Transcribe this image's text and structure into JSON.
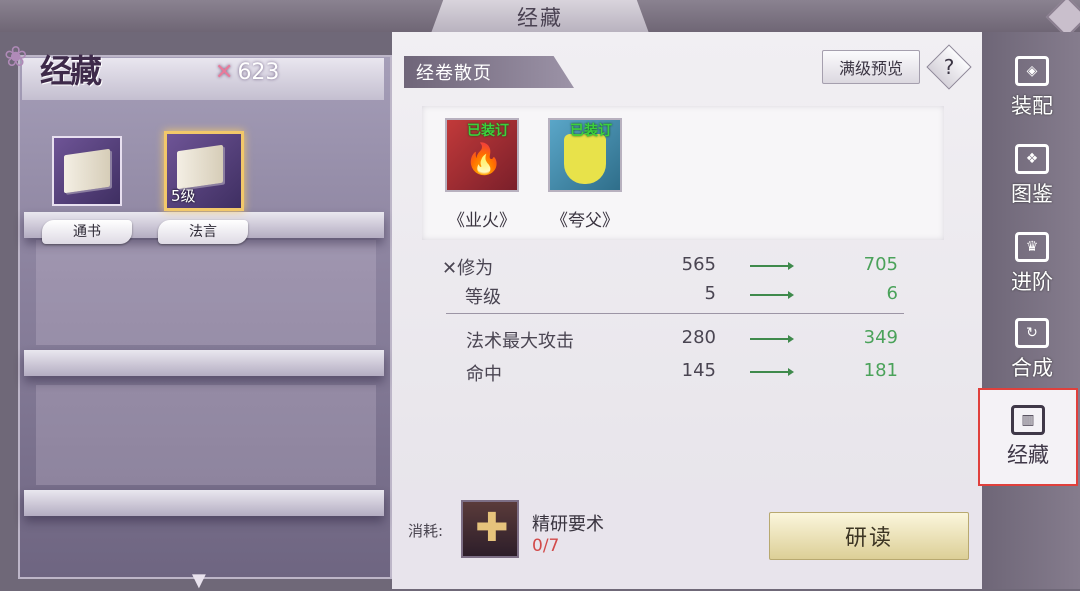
{
  "window": {
    "title": "经藏"
  },
  "left": {
    "logo_text": "经藏",
    "currency_icon": "crossed-swords-icon",
    "currency_value": "623",
    "books": [
      {
        "label": "通书",
        "level": "",
        "selected": false
      },
      {
        "label": "法言",
        "level": "5级",
        "selected": true
      }
    ]
  },
  "right": {
    "section_title": "经卷散页",
    "preview_label": "满级预览",
    "help_label": "?",
    "equipped": [
      {
        "name": "《业火》",
        "tag": "已装订",
        "icon": "fire-book-icon"
      },
      {
        "name": "《夸父》",
        "tag": "已装订",
        "icon": "yellow-scroll-icon"
      }
    ],
    "stats": [
      {
        "label": "修为",
        "icon": "crossed-swords-icon",
        "from": "565",
        "to": "705"
      },
      {
        "label": "等级",
        "from": "5",
        "to": "6"
      },
      {
        "label": "法术最大攻击",
        "from": "280",
        "to": "349"
      },
      {
        "label": "命中",
        "from": "145",
        "to": "181"
      }
    ],
    "cost": {
      "label": "消耗:",
      "item_name": "精研要术",
      "count": "0/7"
    },
    "action_button": "研读"
  },
  "sidebar": {
    "items": [
      {
        "label": "装配",
        "icon": "equip-icon",
        "active": false
      },
      {
        "label": "图鉴",
        "icon": "codex-icon",
        "active": false
      },
      {
        "label": "进阶",
        "icon": "advance-icon",
        "active": false
      },
      {
        "label": "合成",
        "icon": "synthesize-icon",
        "active": false
      },
      {
        "label": "经藏",
        "icon": "scripture-icon",
        "active": true
      }
    ]
  },
  "colors": {
    "accent_gold": "#f2c86a",
    "up_green": "#4aa25a",
    "cost_red": "#d24a4a",
    "active_border": "#e0403c"
  }
}
